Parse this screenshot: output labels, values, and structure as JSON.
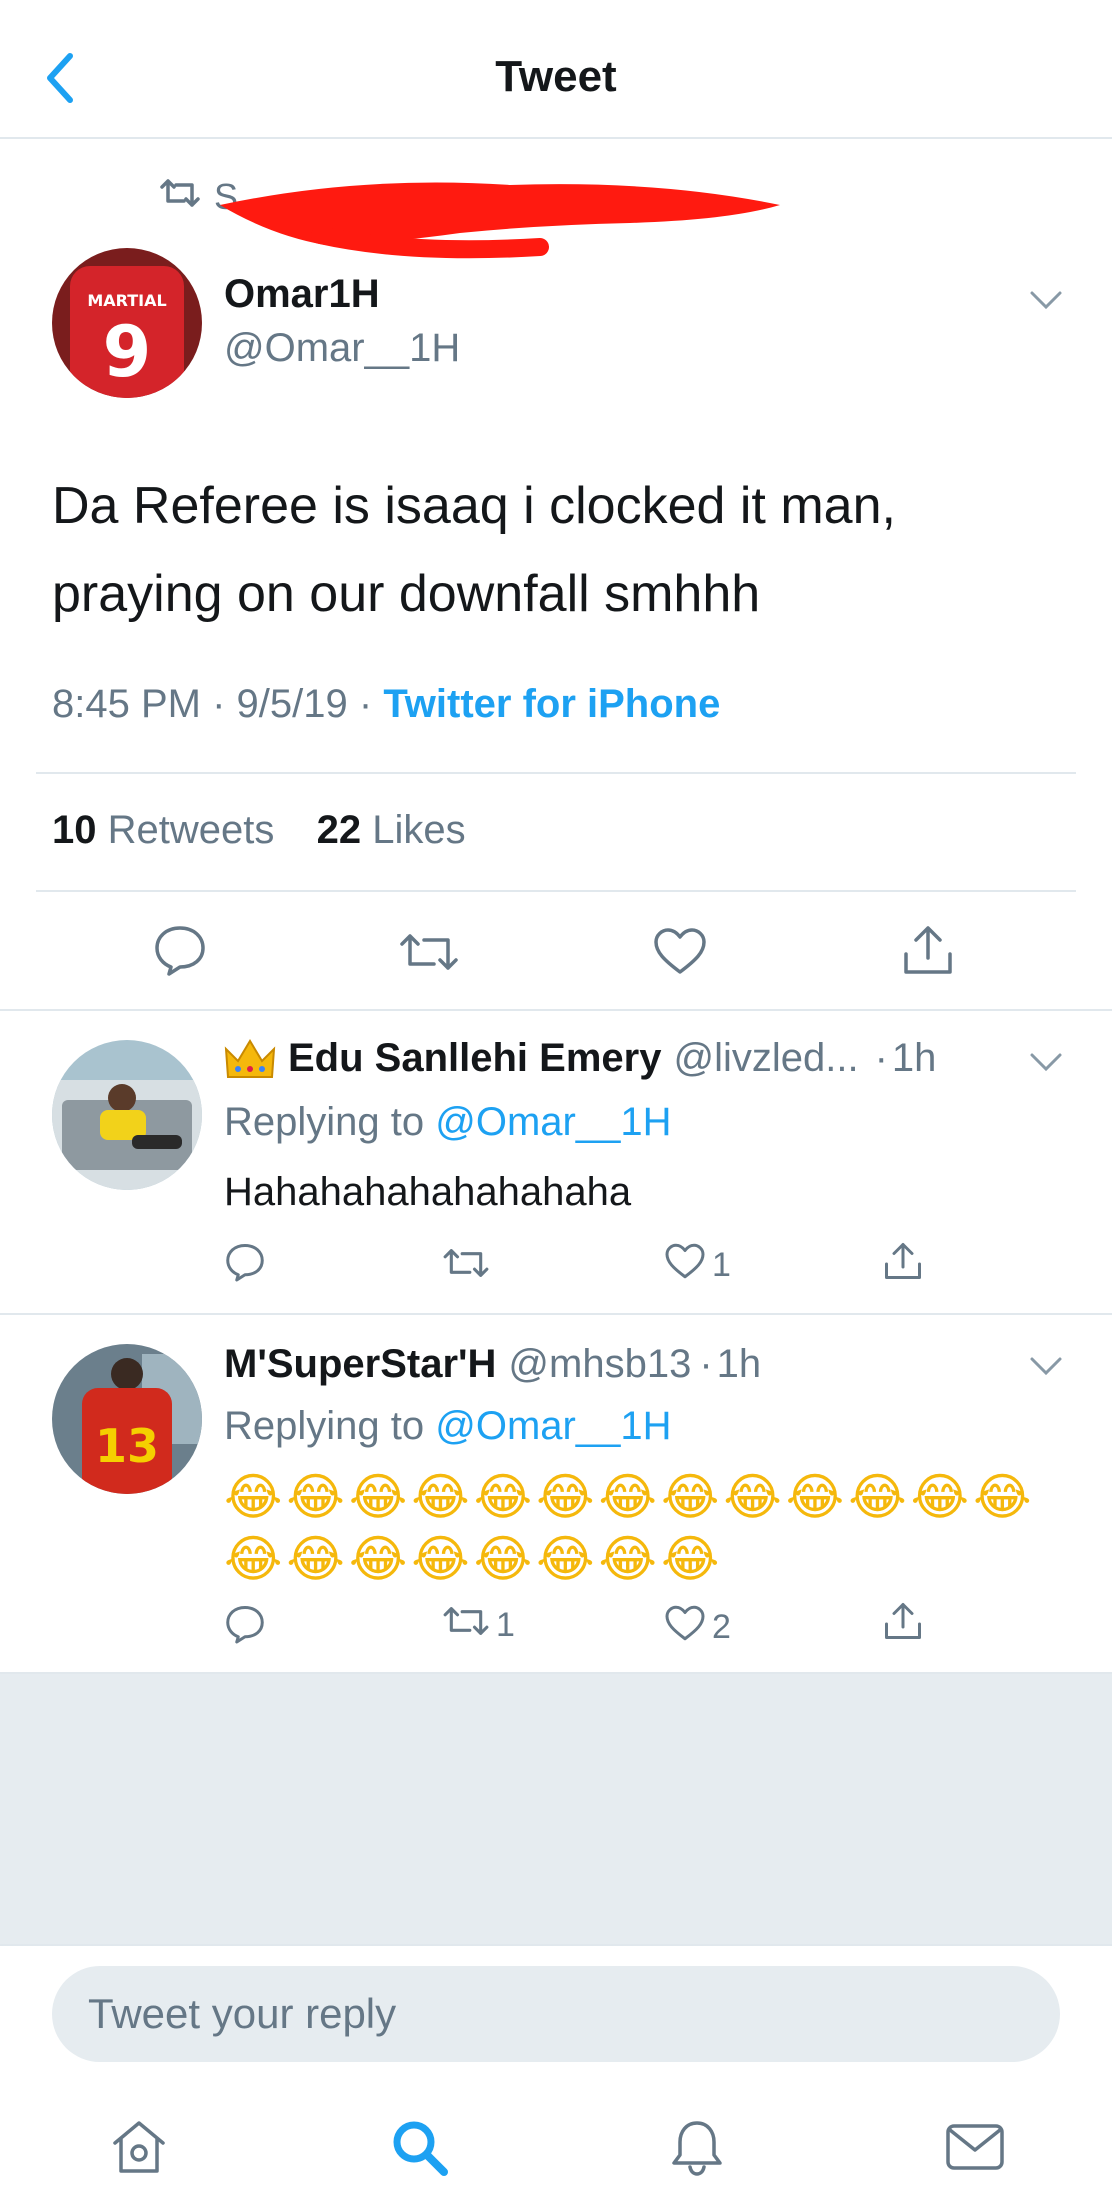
{
  "header": {
    "title": "Tweet"
  },
  "retweet_banner": {
    "visible_prefix": "S"
  },
  "main_tweet": {
    "display_name": "Omar1H",
    "handle": "@Omar__1H",
    "text_line1": "Da Referee is isaaq i clocked it man,",
    "text_line2": "praying on our downfall smhhh",
    "time": "8:45 PM",
    "date": "9/5/19",
    "source": "Twitter for iPhone",
    "retweets_count": "10",
    "retweets_label": "Retweets",
    "likes_count": "22",
    "likes_label": "Likes",
    "avatar_text": "9",
    "avatar_name": "MARTIAL"
  },
  "replies": [
    {
      "display_name": "Edu Sanllehi Emery",
      "handle": "@livzled...",
      "time": "1h",
      "replying_prefix": "Replying to",
      "replying_handle": "@Omar__1H",
      "text": "Hahahahahahahahaha",
      "retweets": "",
      "likes": "1"
    },
    {
      "display_name": "M'SuperStar'H",
      "handle": "@mhsb13",
      "time": "1h",
      "replying_prefix": "Replying to",
      "replying_handle": "@Omar__1H",
      "emoji_line1": "😂😂😂😂😂😂😂😂😂😂😂😂😂",
      "emoji_line2": "😂😂😂😂😂😂😂😂",
      "retweets": "1",
      "likes": "2",
      "avatar_text": "13"
    }
  ],
  "compose": {
    "placeholder": "Tweet your reply"
  },
  "colors": {
    "accent": "#1da1f2",
    "secondary_text": "#657786",
    "divider": "#e1e8ed",
    "background_gray": "#e6ecf0"
  },
  "icons": [
    "back-chevron-icon",
    "retweet-icon",
    "chevron-down-icon",
    "reply-icon",
    "like-icon",
    "share-icon",
    "home-icon",
    "search-icon",
    "notifications-icon",
    "messages-icon"
  ]
}
